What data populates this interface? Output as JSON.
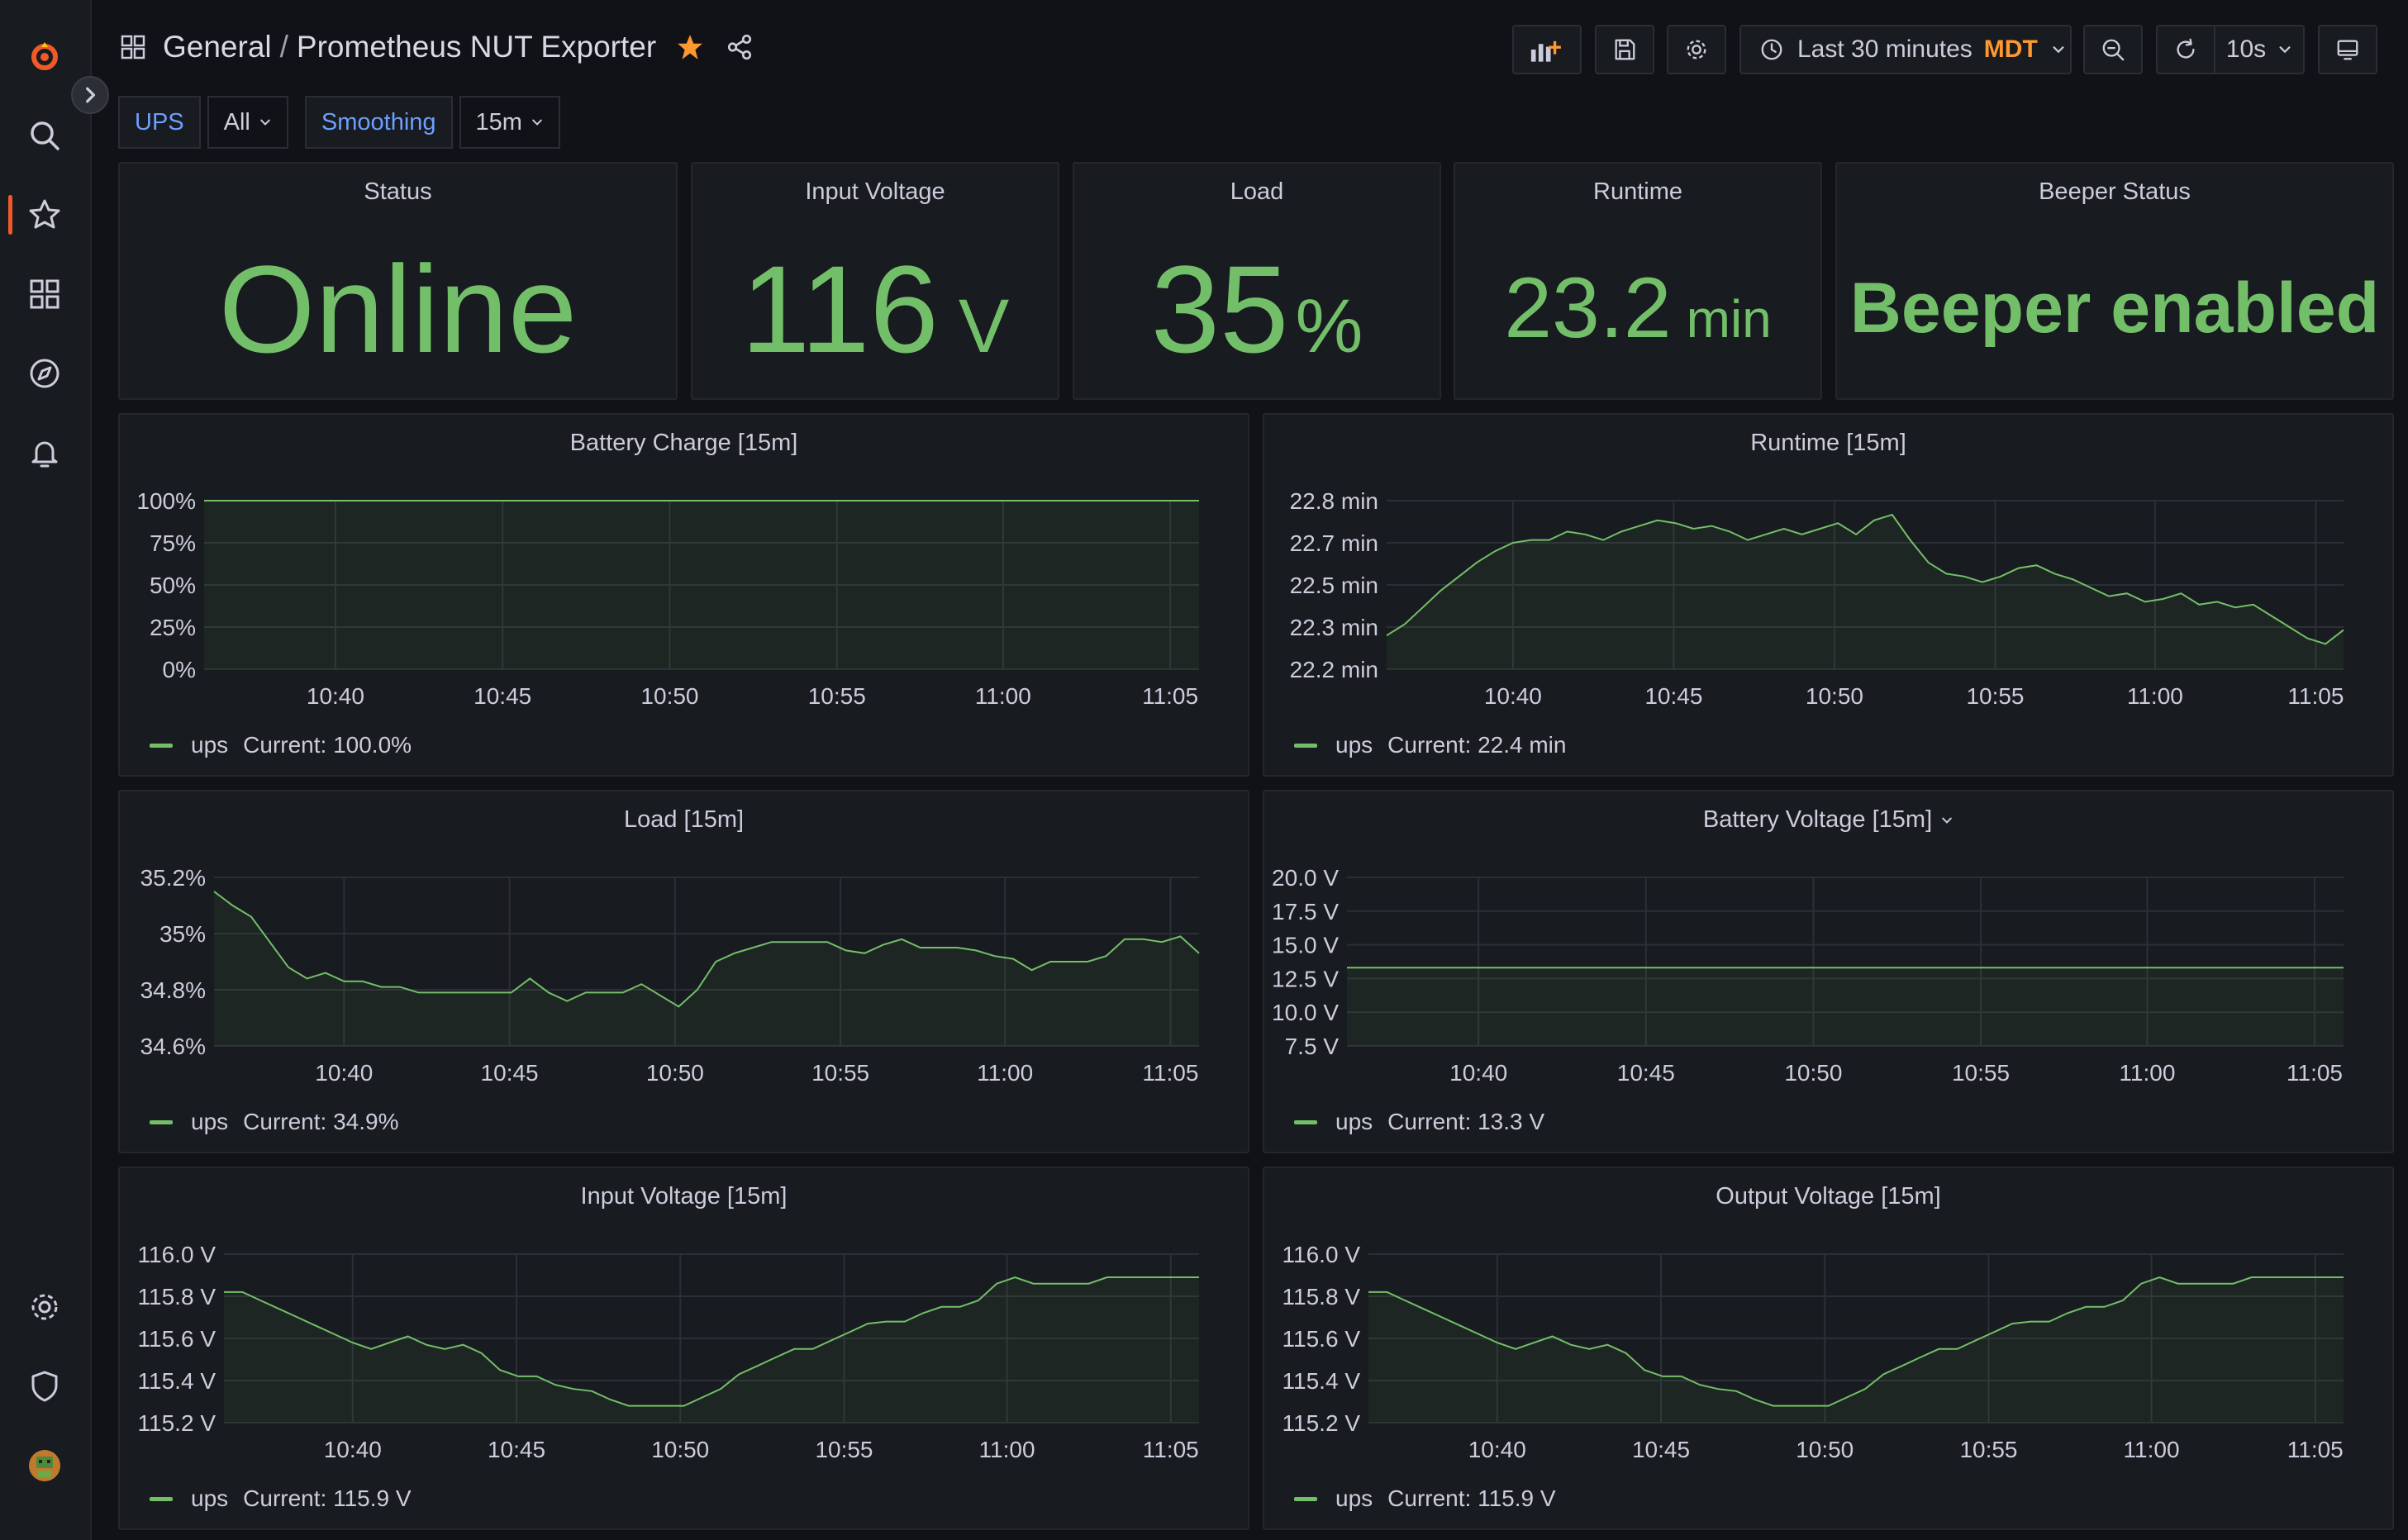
{
  "breadcrumb": {
    "folder": "General",
    "separator": "/",
    "title": "Prometheus NUT Exporter"
  },
  "toolbar": {
    "time_range": "Last 30 minutes",
    "timezone": "MDT",
    "refresh_interval": "10s"
  },
  "variables": [
    {
      "label": "UPS",
      "value": "All"
    },
    {
      "label": "Smoothing",
      "value": "15m"
    }
  ],
  "stats": {
    "status": {
      "title": "Status",
      "value": "Online",
      "unit": ""
    },
    "input_voltage": {
      "title": "Input Voltage",
      "value": "116",
      "unit": "V"
    },
    "load": {
      "title": "Load",
      "value": "35",
      "unit": "%"
    },
    "runtime": {
      "title": "Runtime",
      "value": "23.2",
      "unit": "min"
    },
    "beeper": {
      "title": "Beeper Status",
      "value": "Beeper enabled",
      "unit": ""
    }
  },
  "colors": {
    "accent": "#73bf69",
    "brand": "#f05a28",
    "star": "#ff9830",
    "link": "#6e9fff",
    "background": "#111217",
    "panel": "#181b1f"
  },
  "chart_data": [
    {
      "id": "battery_charge",
      "type": "area",
      "title": "Battery Charge [15m]",
      "x": [
        "10:40",
        "10:45",
        "10:50",
        "10:55",
        "11:00",
        "11:05"
      ],
      "y_ticks": [
        "100%",
        "75%",
        "50%",
        "25%",
        "0%"
      ],
      "ylim": [
        0,
        100
      ],
      "series": [
        {
          "name": "ups",
          "values": [
            100,
            100,
            100,
            100,
            100,
            100,
            100,
            100,
            100,
            100,
            100,
            100,
            100,
            100,
            100,
            100,
            100,
            100,
            100,
            100,
            100,
            100,
            100,
            100,
            100,
            100,
            100,
            100,
            100,
            100,
            100
          ]
        }
      ],
      "legend": {
        "name": "ups",
        "current": "Current: 100.0%"
      }
    },
    {
      "id": "runtime",
      "type": "area",
      "title": "Runtime [15m]",
      "x": [
        "10:40",
        "10:45",
        "10:50",
        "10:55",
        "11:00",
        "11:05"
      ],
      "y_ticks": [
        "22.8 min",
        "22.7 min",
        "22.5 min",
        "22.3 min",
        "22.2 min"
      ],
      "ylim": [
        22.2,
        22.8
      ],
      "series": [
        {
          "name": "ups",
          "values": [
            22.32,
            22.36,
            22.42,
            22.48,
            22.53,
            22.58,
            22.62,
            22.65,
            22.66,
            22.66,
            22.69,
            22.68,
            22.66,
            22.69,
            22.71,
            22.73,
            22.72,
            22.7,
            22.71,
            22.69,
            22.66,
            22.68,
            22.7,
            22.68,
            22.7,
            22.72,
            22.68,
            22.73,
            22.75,
            22.66,
            22.58,
            22.54,
            22.53,
            22.51,
            22.53,
            22.56,
            22.57,
            22.54,
            22.52,
            22.49,
            22.46,
            22.47,
            22.44,
            22.45,
            22.47,
            22.43,
            22.44,
            22.42,
            22.43,
            22.39,
            22.35,
            22.31,
            22.29,
            22.34
          ]
        }
      ],
      "legend": {
        "name": "ups",
        "current": "Current: 22.4 min"
      }
    },
    {
      "id": "load",
      "type": "area",
      "title": "Load [15m]",
      "x": [
        "10:40",
        "10:45",
        "10:50",
        "10:55",
        "11:00",
        "11:05"
      ],
      "y_ticks": [
        "35.2%",
        "35%",
        "34.8%",
        "34.6%"
      ],
      "ylim": [
        34.6,
        35.2
      ],
      "series": [
        {
          "name": "ups",
          "values": [
            35.15,
            35.1,
            35.06,
            34.97,
            34.88,
            34.84,
            34.86,
            34.83,
            34.83,
            34.81,
            34.81,
            34.79,
            34.79,
            34.79,
            34.79,
            34.79,
            34.79,
            34.84,
            34.79,
            34.76,
            34.79,
            34.79,
            34.79,
            34.82,
            34.78,
            34.74,
            34.8,
            34.9,
            34.93,
            34.95,
            34.97,
            34.97,
            34.97,
            34.97,
            34.94,
            34.93,
            34.96,
            34.98,
            34.95,
            34.95,
            34.95,
            34.94,
            34.92,
            34.91,
            34.87,
            34.9,
            34.9,
            34.9,
            34.92,
            34.98,
            34.98,
            34.97,
            34.99,
            34.93
          ]
        }
      ],
      "legend": {
        "name": "ups",
        "current": "Current: 34.9%"
      }
    },
    {
      "id": "battery_voltage",
      "type": "area",
      "title": "Battery Voltage [15m]",
      "x": [
        "10:40",
        "10:45",
        "10:50",
        "10:55",
        "11:00",
        "11:05"
      ],
      "y_ticks": [
        "20.0 V",
        "17.5 V",
        "15.0 V",
        "12.5 V",
        "10.0 V",
        "7.5 V"
      ],
      "ylim": [
        7.5,
        20
      ],
      "series": [
        {
          "name": "ups",
          "values": [
            13.3,
            13.3,
            13.3,
            13.3,
            13.3,
            13.3,
            13.3,
            13.3,
            13.3,
            13.3,
            13.3,
            13.3,
            13.3,
            13.3,
            13.3,
            13.3,
            13.3,
            13.3,
            13.3,
            13.3,
            13.3,
            13.3,
            13.3,
            13.3,
            13.3,
            13.3,
            13.3,
            13.3,
            13.3,
            13.3,
            13.3
          ]
        }
      ],
      "legend": {
        "name": "ups",
        "current": "Current: 13.3 V"
      }
    },
    {
      "id": "input_voltage",
      "type": "area",
      "title": "Input Voltage [15m]",
      "x": [
        "10:40",
        "10:45",
        "10:50",
        "10:55",
        "11:00",
        "11:05"
      ],
      "y_ticks": [
        "116.0 V",
        "115.8 V",
        "115.6 V",
        "115.4 V",
        "115.2 V"
      ],
      "ylim": [
        115.2,
        116.0
      ],
      "series": [
        {
          "name": "ups",
          "values": [
            115.82,
            115.82,
            115.78,
            115.74,
            115.7,
            115.66,
            115.62,
            115.58,
            115.55,
            115.58,
            115.61,
            115.57,
            115.55,
            115.57,
            115.53,
            115.45,
            115.42,
            115.42,
            115.38,
            115.36,
            115.35,
            115.31,
            115.28,
            115.28,
            115.28,
            115.28,
            115.32,
            115.36,
            115.43,
            115.47,
            115.51,
            115.55,
            115.55,
            115.59,
            115.63,
            115.67,
            115.68,
            115.68,
            115.72,
            115.75,
            115.75,
            115.78,
            115.86,
            115.89,
            115.86,
            115.86,
            115.86,
            115.86,
            115.89,
            115.89,
            115.89,
            115.89,
            115.89,
            115.89
          ]
        }
      ],
      "legend": {
        "name": "ups",
        "current": "Current: 115.9 V"
      }
    },
    {
      "id": "output_voltage",
      "type": "area",
      "title": "Output Voltage [15m]",
      "x": [
        "10:40",
        "10:45",
        "10:50",
        "10:55",
        "11:00",
        "11:05"
      ],
      "y_ticks": [
        "116.0 V",
        "115.8 V",
        "115.6 V",
        "115.4 V",
        "115.2 V"
      ],
      "ylim": [
        115.2,
        116.0
      ],
      "series": [
        {
          "name": "ups",
          "values": [
            115.82,
            115.82,
            115.78,
            115.74,
            115.7,
            115.66,
            115.62,
            115.58,
            115.55,
            115.58,
            115.61,
            115.57,
            115.55,
            115.57,
            115.53,
            115.45,
            115.42,
            115.42,
            115.38,
            115.36,
            115.35,
            115.31,
            115.28,
            115.28,
            115.28,
            115.28,
            115.32,
            115.36,
            115.43,
            115.47,
            115.51,
            115.55,
            115.55,
            115.59,
            115.63,
            115.67,
            115.68,
            115.68,
            115.72,
            115.75,
            115.75,
            115.78,
            115.86,
            115.89,
            115.86,
            115.86,
            115.86,
            115.86,
            115.89,
            115.89,
            115.89,
            115.89,
            115.89,
            115.89
          ]
        }
      ],
      "legend": {
        "name": "ups",
        "current": "Current: 115.9 V"
      }
    }
  ]
}
